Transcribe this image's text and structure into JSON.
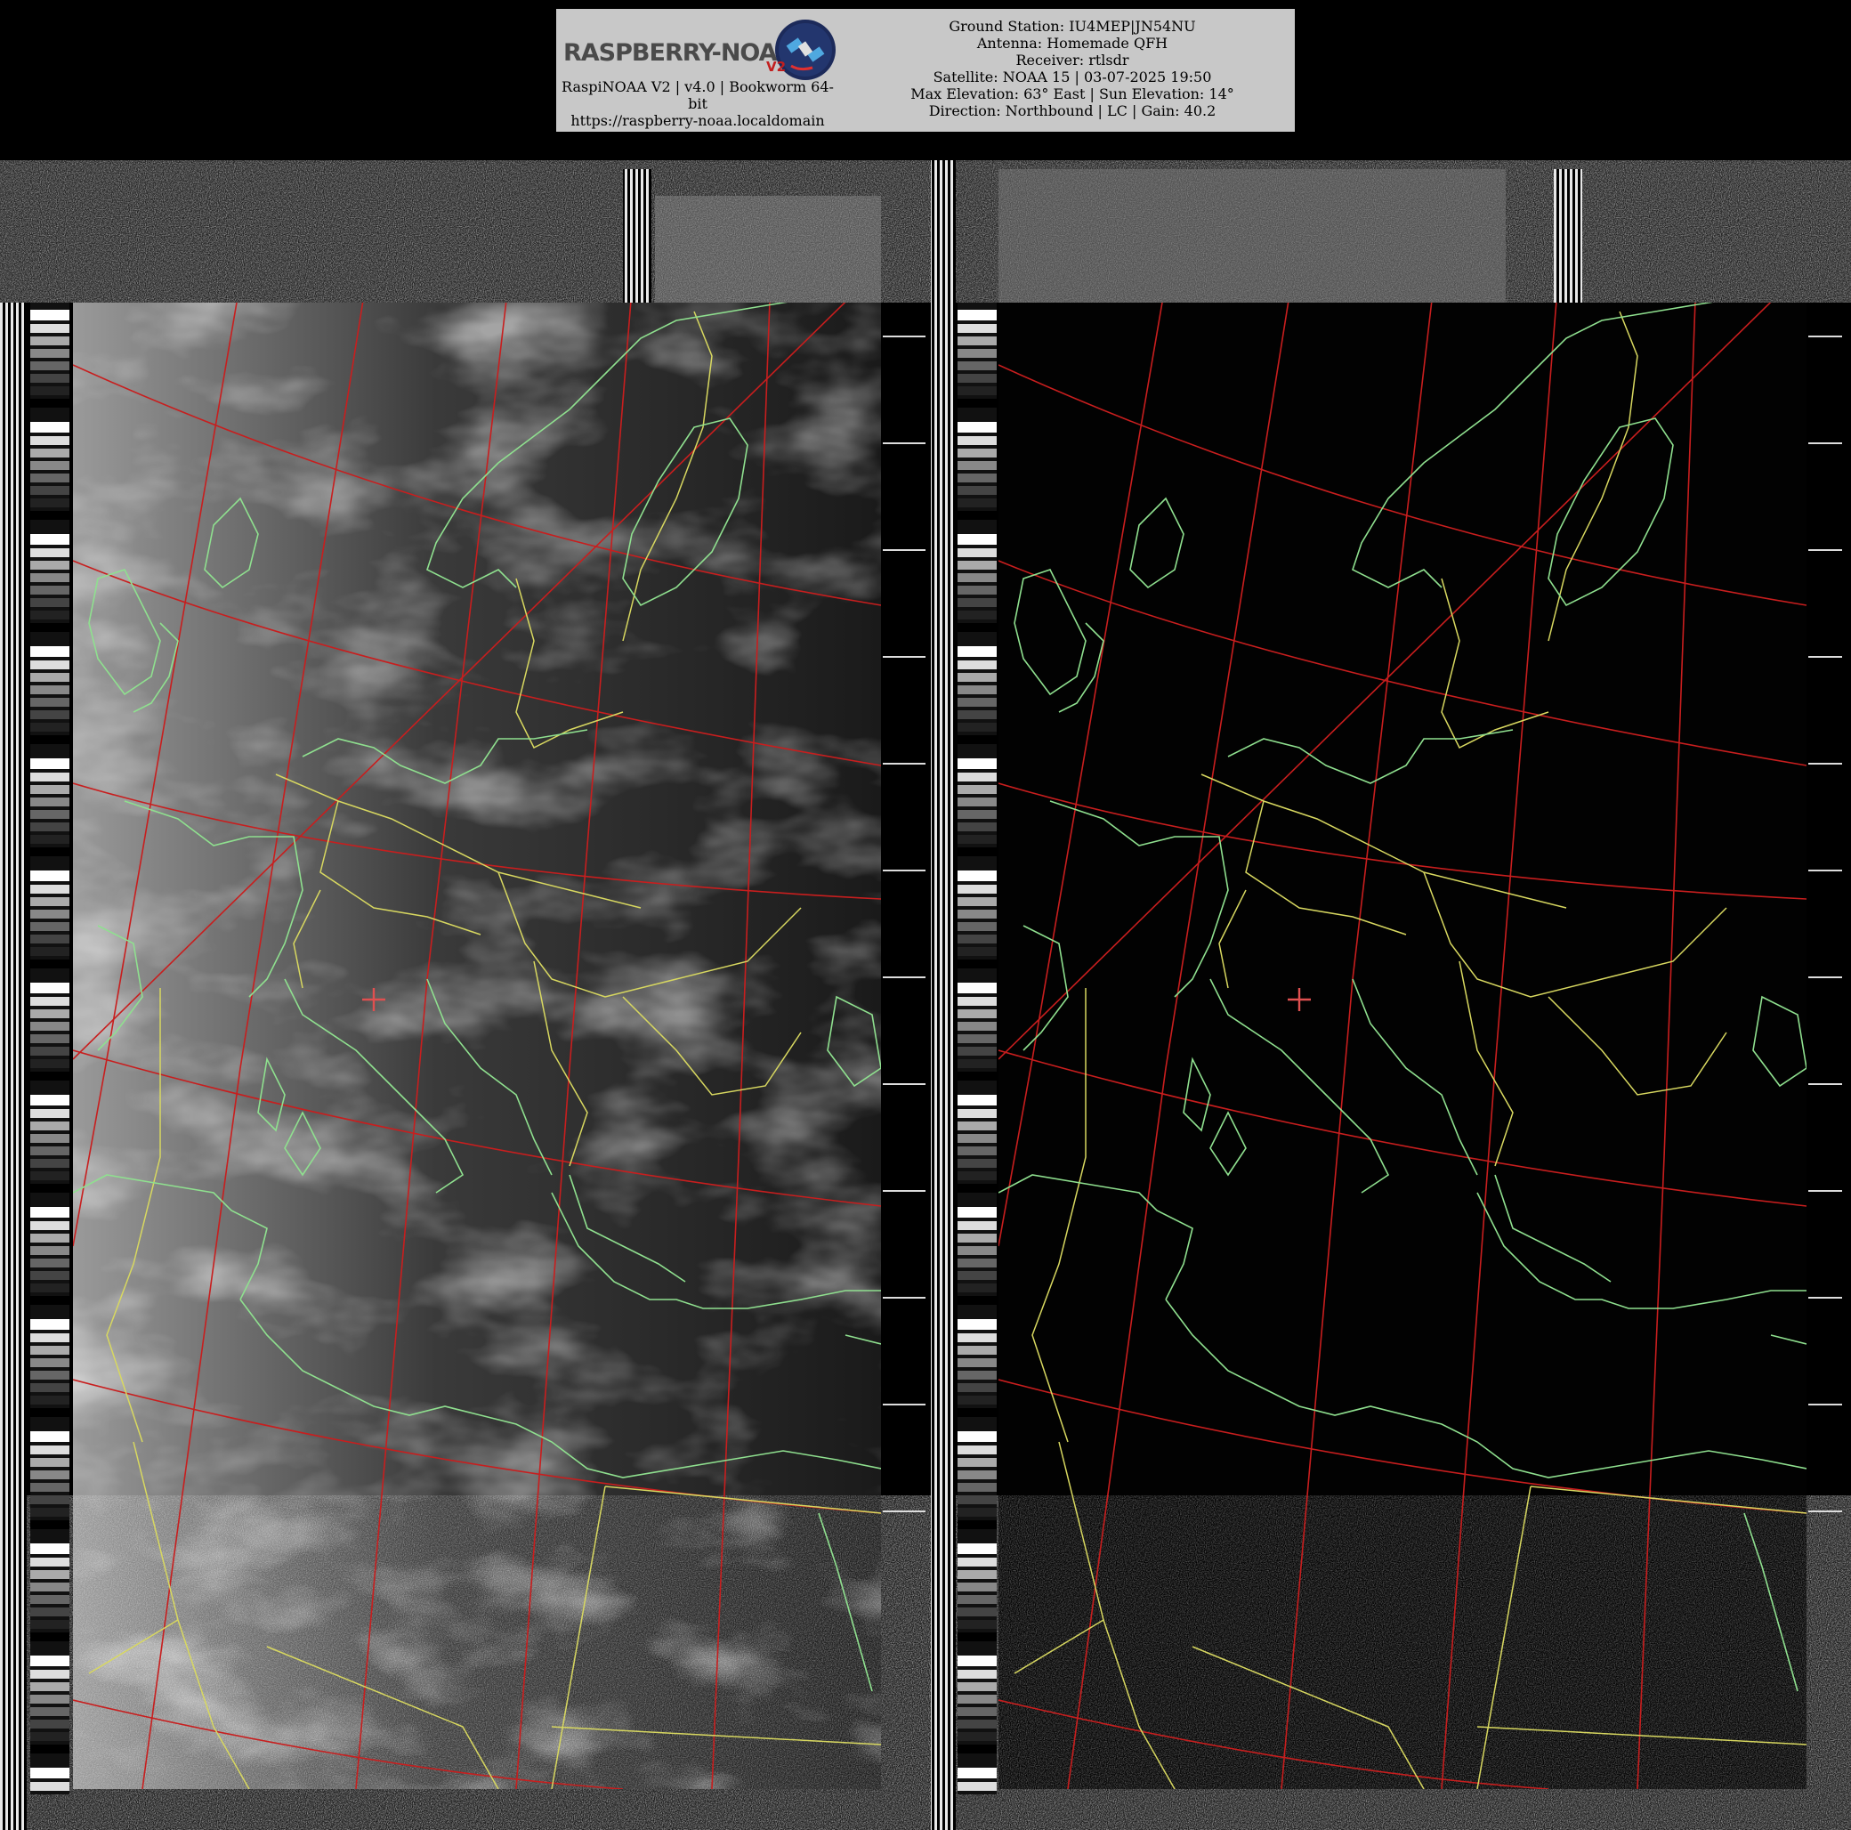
{
  "header": {
    "logo_text": "RASPBERRY-NOAA",
    "logo_version": "V2",
    "left_lines": [
      "RaspiNOAA V2 | v4.0 | Bookworm 64-",
      "bit",
      "https://raspberry-noaa.localdomain"
    ],
    "right_lines": [
      "Ground Station: IU4MEP|JN54NU",
      "Antenna: Homemade QFH",
      "Receiver: rtlsdr",
      "Satellite: NOAA 15 | 03-07-2025 19:50",
      "Max Elevation: 63° East | Sun Elevation: 14°",
      "Direction: Northbound | LC | Gain: 40.2"
    ]
  },
  "colors": {
    "coastline": "#8fe08f",
    "borders": "#d8d860",
    "graticule": "#c81e1e",
    "station_marker": "#e05050"
  }
}
